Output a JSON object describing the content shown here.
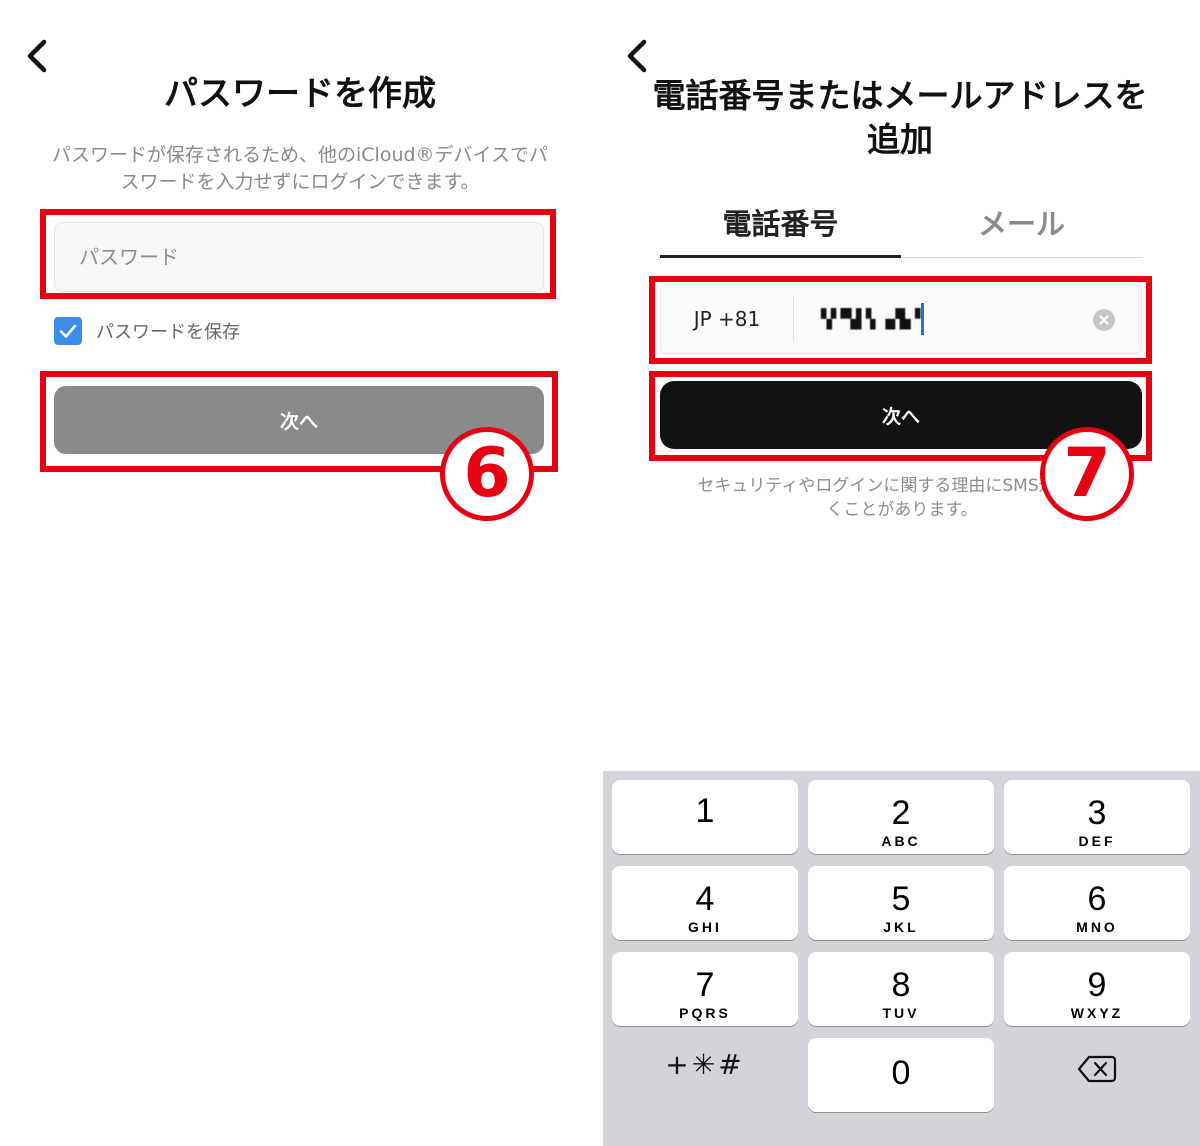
{
  "left": {
    "title": "パスワードを作成",
    "description": "パスワードが保存されるため、他のiCloud®デバイスでパスワードを入力せずにログインできます。",
    "password_placeholder": "パスワード",
    "save_password_label": "パスワードを保存",
    "save_password_checked": true,
    "next_label": "次へ",
    "step_badge": "6"
  },
  "right": {
    "title": "電話番号またはメールアドレスを追加",
    "tabs": [
      {
        "label": "電話番号",
        "active": true
      },
      {
        "label": "メール",
        "active": false
      }
    ],
    "country_code": "JP +81",
    "phone_value": "▚▘▀▟▝▖▗▞▙▝",
    "next_label": "次へ",
    "sms_note": "セキュリティやログインに関する理由にSMS通知が届くことがあります。",
    "step_badge": "7"
  },
  "keypad": {
    "keys": [
      {
        "num": "1",
        "letters": ""
      },
      {
        "num": "2",
        "letters": "ABC"
      },
      {
        "num": "3",
        "letters": "DEF"
      },
      {
        "num": "4",
        "letters": "GHI"
      },
      {
        "num": "5",
        "letters": "JKL"
      },
      {
        "num": "6",
        "letters": "MNO"
      },
      {
        "num": "7",
        "letters": "PQRS"
      },
      {
        "num": "8",
        "letters": "TUV"
      },
      {
        "num": "9",
        "letters": "WXYZ"
      },
      {
        "num": "0",
        "letters": ""
      }
    ],
    "symbols_label": "+✳#"
  },
  "colors": {
    "highlight_red": "#e60012",
    "checkbox_blue": "#3a8ee6",
    "caret_blue": "#2a6fd6",
    "disabled_button": "#8a8a8a",
    "primary_button": "#121212",
    "keypad_bg": "#d2d4d9"
  }
}
